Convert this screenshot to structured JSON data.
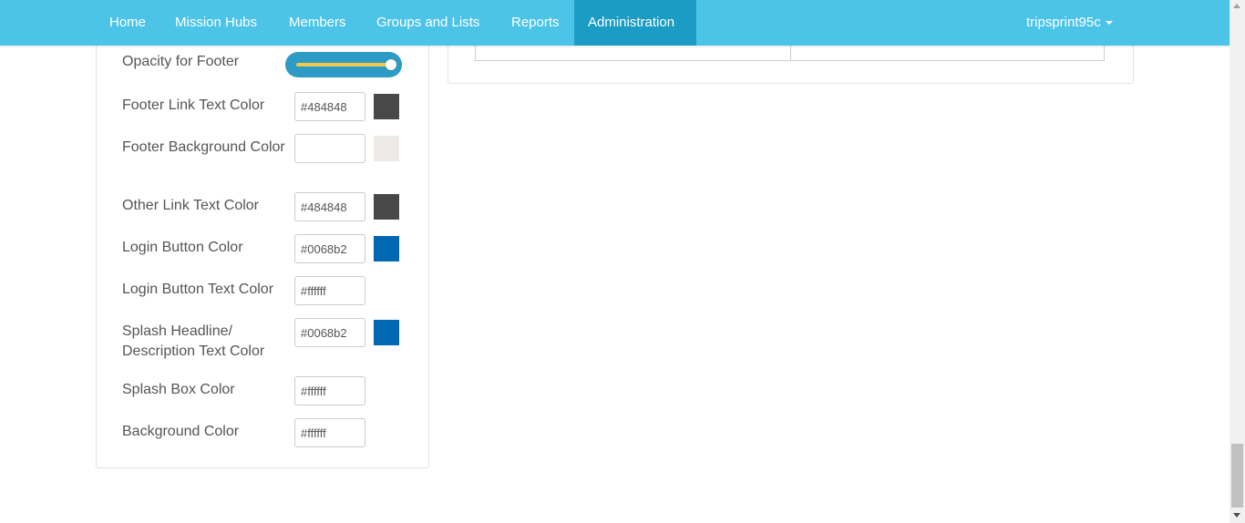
{
  "nav": {
    "items": [
      {
        "label": "Home"
      },
      {
        "label": "Mission Hubs"
      },
      {
        "label": "Members"
      },
      {
        "label": "Groups and Lists"
      },
      {
        "label": "Reports"
      },
      {
        "label": "Administration",
        "active": true
      }
    ],
    "user": "tripsprint95c",
    "user_icon": "caret-down-icon"
  },
  "settings": {
    "opacity_footer": {
      "label": "Opacity for Footer",
      "value": 1.0
    },
    "footer_link_text": {
      "label": "Footer Link Text Color",
      "value": "#484848",
      "swatch": "#484848"
    },
    "footer_background": {
      "label": "Footer Background Color",
      "value": "",
      "swatch": "#ece9e6"
    },
    "other_link_text": {
      "label": "Other Link Text Color",
      "value": "#484848",
      "swatch": "#484848"
    },
    "login_button": {
      "label": "Login Button Color",
      "value": "#0068b2",
      "swatch": "#0068b2"
    },
    "login_button_text": {
      "label": "Login Button Text Color",
      "value": "#ffffff"
    },
    "splash_headline": {
      "label": "Splash Headline/ Description Text Color",
      "value": "#0068b2",
      "swatch": "#0068b2"
    },
    "splash_box": {
      "label": "Splash Box Color",
      "value": "#ffffff"
    },
    "background": {
      "label": "Background Color",
      "value": "#ffffff"
    }
  },
  "colors": {
    "nav_bg": "#4cc4e8",
    "nav_active": "#1a9cc4",
    "slider_bg": "#2d9bc6",
    "slider_track": "#f2c94c"
  }
}
